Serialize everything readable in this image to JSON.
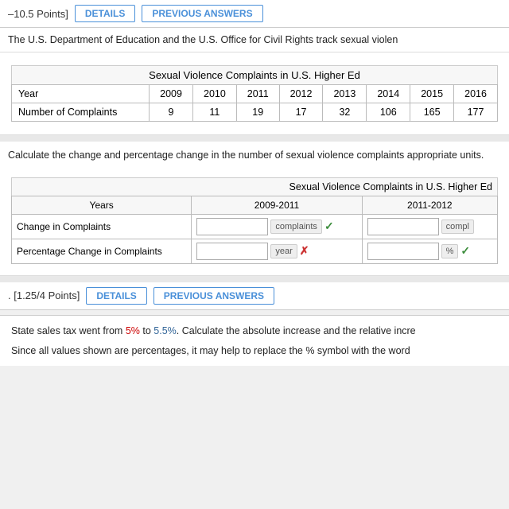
{
  "top_bar": {
    "points_label": "–10.5 Points]",
    "details_btn": "DETAILS",
    "previous_answers_btn": "PREVIOUS ANSWERS"
  },
  "intro": {
    "text": "The U.S. Department of Education and the U.S. Office for Civil Rights track sexual violen"
  },
  "data_table": {
    "caption": "Sexual Violence Complaints in U.S. Higher Ed",
    "row1_header": "Year",
    "years": [
      "2009",
      "2010",
      "2011",
      "2012",
      "2013",
      "2014",
      "2015",
      "2016"
    ],
    "row2_header": "Number of Complaints",
    "values": [
      "9",
      "11",
      "19",
      "17",
      "32",
      "106",
      "165",
      "177"
    ]
  },
  "question_text": "Calculate the change and percentage change in the number of sexual violence complaints appropriate units.",
  "answer_table": {
    "caption": "Sexual Violence Complaints in U.S. Higher Ed",
    "col_years_label": "Years",
    "col1": "2009-2011",
    "col2": "2011-2012",
    "row1_header": "Change in Complaints",
    "row2_header": "Percentage Change in Complaints",
    "row1_unit1": "complaints",
    "row1_unit2": "compl",
    "row2_unit1": "year",
    "row2_unit2": "%",
    "row1_check1": "✓",
    "row1_check2": "",
    "row2_check1": "✗",
    "row2_check2": "✓"
  },
  "bottom_bar": {
    "points_label": ". [1.25/4 Points]",
    "details_btn": "DETAILS",
    "previous_answers_btn": "PREVIOUS ANSWERS"
  },
  "bottom_text": {
    "line1_pre": "State sales tax went from ",
    "line1_val1": "5%",
    "line1_mid": " to ",
    "line1_val2": "5.5%",
    "line1_post": ". Calculate the absolute increase and the relative incre",
    "line2": "Since all values shown are percentages, it may help to replace the % symbol with the word"
  }
}
